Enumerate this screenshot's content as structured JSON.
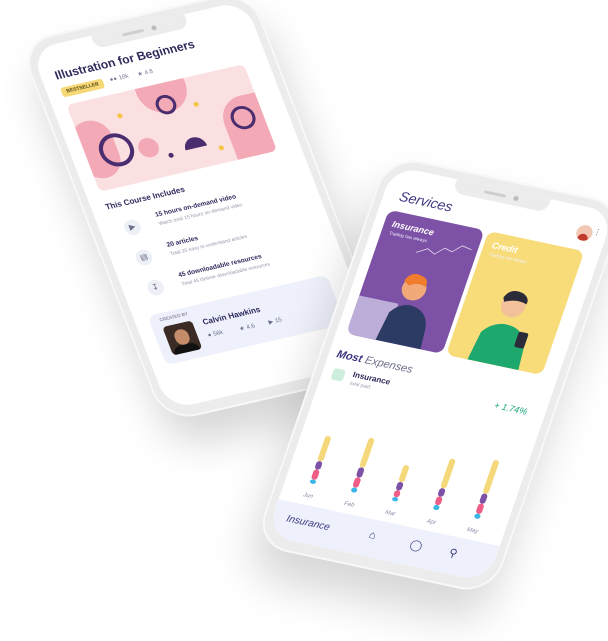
{
  "course": {
    "title": "Illustration for Beginners",
    "badge": "BESTSELLER",
    "students": "18k",
    "rating": "4.8",
    "includes_title": "This Course Includes",
    "items": [
      {
        "icon": "video-icon",
        "title": "15 hours on-demand video",
        "subtitle": "Watch total 15 hours on-demand video"
      },
      {
        "icon": "article-icon",
        "title": "20 articles",
        "subtitle": "Total 20 easy to understand articles"
      },
      {
        "icon": "download-icon",
        "title": "45 downloadable resources",
        "subtitle": "Total 45 lifetime downloadable resources"
      }
    ],
    "creator": {
      "label": "CREATED BY",
      "name": "Calvin Hawkins",
      "followers": "56k",
      "rating": "4.6",
      "videos": "15"
    }
  },
  "services": {
    "title": "Services",
    "cards": [
      {
        "title": "Insurance",
        "subtitle": "Trading has always"
      },
      {
        "title": "Credit",
        "subtitle": "Trading has always"
      }
    ],
    "expenses_title_bold": "Most",
    "expenses_title_rest": "Expenses",
    "expense": {
      "name": "Insurance",
      "subtitle": "total paid",
      "change": "+ 1.74%"
    },
    "tabbar_label": "Insurance",
    "tab_icons": [
      "home-icon",
      "shield-icon",
      "search-icon"
    ]
  },
  "colors": {
    "primary": "#3d3880",
    "purple_card": "#7d52a6",
    "yellow_card": "#f8dc7a",
    "green": "#1aa27b",
    "bar_yellow": "#f4d879",
    "bar_purple": "#7d52a6",
    "bar_pink": "#ef5c88",
    "bar_blue": "#3bb6e6"
  },
  "chart_data": {
    "type": "bar",
    "stacked": true,
    "categories": [
      "Jun",
      "Feb",
      "Mar",
      "Apr",
      "May"
    ],
    "series": [
      {
        "values": [
          0.3,
          0.35,
          0.2,
          0.35,
          0.4
        ]
      },
      {
        "values": [
          0.1,
          0.12,
          0.1,
          0.1,
          0.12
        ]
      },
      {
        "values": [
          0.12,
          0.12,
          0.08,
          0.1,
          0.12
        ]
      },
      {
        "values": [
          0.05,
          0.06,
          0.05,
          0.06,
          0.06
        ]
      }
    ],
    "ylim": [
      0,
      1
    ]
  }
}
